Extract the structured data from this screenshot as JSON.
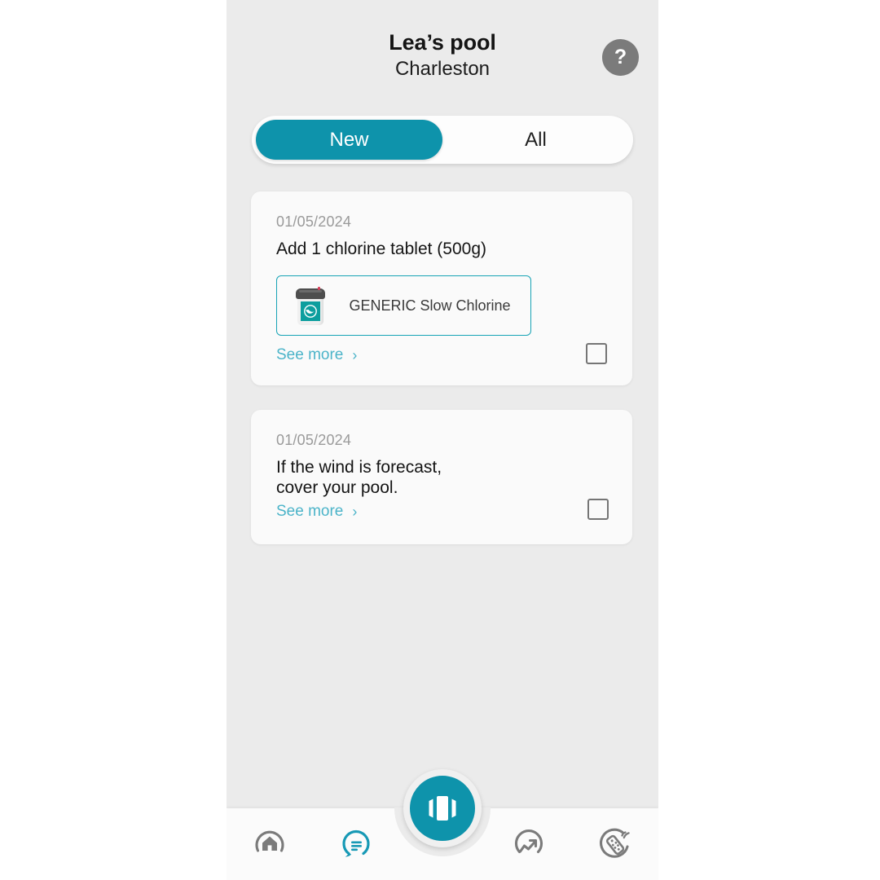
{
  "header": {
    "title": "Lea’s pool",
    "subtitle": "Charleston",
    "help_icon": "question-mark-icon",
    "help_glyph": "?"
  },
  "filter_tabs": {
    "selected": "New",
    "options": [
      {
        "label": "New",
        "active": true
      },
      {
        "label": "All",
        "active": false
      }
    ]
  },
  "cards": [
    {
      "date": "01/05/2024",
      "title": "Add 1 chlorine tablet (500g)",
      "product": {
        "name": "GENERIC Slow Chlorine",
        "thumb_icon": "chlorine-bucket-icon"
      },
      "see_more_label": "See more",
      "chevron_glyph": "›",
      "checkbox_checked": false
    },
    {
      "date": "01/05/2024",
      "title": "If the wind is forecast,\ncover your pool.",
      "see_more_label": "See more",
      "chevron_glyph": "›",
      "checkbox_checked": false
    }
  ],
  "bottom_nav": {
    "items": [
      {
        "name": "home",
        "icon": "home-arc-icon",
        "active": false
      },
      {
        "name": "messages",
        "icon": "chat-bubble-icon",
        "active": true
      },
      {
        "name": "analytics",
        "icon": "trend-arrow-arc-icon",
        "active": false
      },
      {
        "name": "remote",
        "icon": "remote-control-icon",
        "active": false
      }
    ],
    "fab": {
      "name": "carousel",
      "icon": "carousel-slides-icon"
    }
  },
  "colors": {
    "accent": "#0e93ab",
    "accent_light": "#4cb4c9",
    "product_border": "#17a3b5",
    "page_bg": "#ebebeb",
    "card_bg": "#fafafa",
    "icon_gray": "#7b7b7b",
    "text_dark": "#141414",
    "text_muted": "#9a9a9a"
  }
}
